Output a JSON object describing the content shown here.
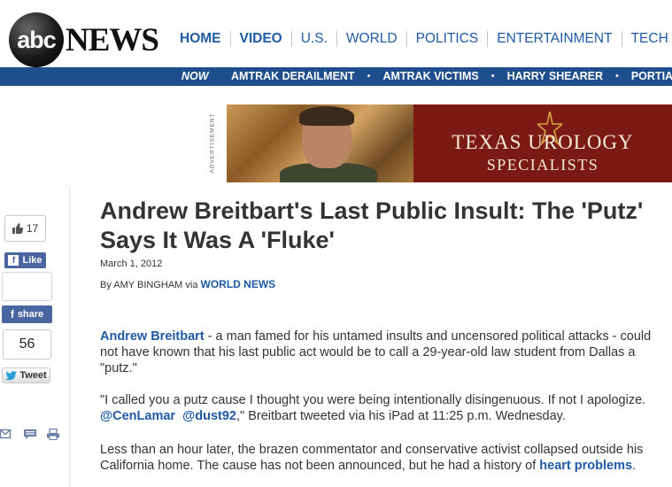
{
  "header": {
    "logo_abc": "abc",
    "logo_news": "NEWS",
    "nav": [
      "HOME",
      "VIDEO",
      "U.S.",
      "WORLD",
      "POLITICS",
      "ENTERTAINMENT",
      "TECH"
    ]
  },
  "trending": {
    "now_label": "NOW",
    "links": [
      "AMTRAK DERAILMENT",
      "AMTRAK VICTIMS",
      "HARRY SHEARER",
      "PORTIA DE"
    ]
  },
  "ad": {
    "label": "ADVERTISEMENT",
    "brand_line1": "TEXAS UROLOGY",
    "brand_line2": "SPECIALISTS"
  },
  "share": {
    "like_count": "17",
    "like_label": "Like",
    "share_label": "share",
    "tweet_count": "56",
    "tweet_label": "Tweet"
  },
  "article": {
    "headline": "Andrew Breitbart's Last Public Insult: The 'Putz' Says It Was A 'Fluke'",
    "date": "March 1, 2012",
    "byline_prefix": "By AMY BINGHAM via",
    "byline_source": "WORLD NEWS",
    "p1_link": "Andrew Breitbart",
    "p1_text": " - a man famed for his untamed insults and uncensored political attacks - could not have known that his last public act would be to call a 29-year-old law student from Dallas a \"putz.\"",
    "p2_text_start": "\"I called you a putz cause I thought you were being intentionally disingenuous. If not I apologize.",
    "p2_link1": "@CenLamar",
    "p2_link2": "@dust92",
    "p2_text_end": ",\" Breitbart tweeted via his iPad at 11:25 p.m. Wednesday.",
    "p3_text": "Less than an hour later, the brazen commentator and conservative activist collapsed outside his California home. The cause has not been announced, but he had a history of ",
    "p3_link": "heart problems",
    "p3_end": "."
  }
}
